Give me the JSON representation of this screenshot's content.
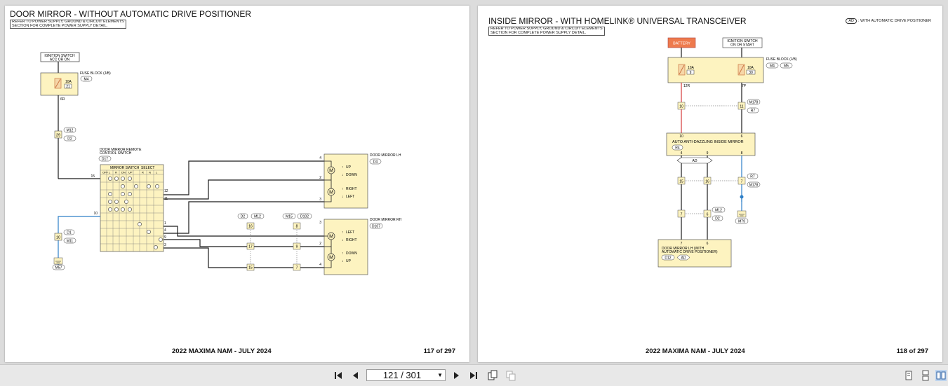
{
  "left_page": {
    "title": "DOOR MIRROR - WITHOUT AUTOMATIC DRIVE POSITIONER",
    "note": "REFER TO POWER SUPPLY, GROUND & CIRCUIT ELEMENTS\nSECTION FOR COMPLETE POWER SUPPLY DETAIL.",
    "footer_center": "2022 MAXIMA NAM - JULY 2024",
    "footer_page": "117 of 297",
    "diagram": {
      "ign_l1": "IGNITION SWITCH",
      "ign_l2": "ACC OR ON",
      "fuse_block": "FUSE BLOCK (J/B)",
      "fuse_conn": "M4",
      "fuse_amp": "10A",
      "fuse_num": "21",
      "wire_6r": "6R",
      "pin_29": "29",
      "conn_m12": "M12",
      "conn_d2": "D2",
      "switch_l1": "DOOR MIRROR REMOTE",
      "switch_l2": "CONTROL SWITCH",
      "switch_conn": "D17",
      "mirror_switch": "MIRROR SWITCH",
      "select": "SELECT",
      "col_off": "OFF",
      "col_l": "L",
      "col_r": "R",
      "col_dn": "DN",
      "col_up": "UP",
      "col_sr": "R",
      "col_sn": "N",
      "col_sl": "L",
      "pin_15": "15",
      "pin_12": "12",
      "pin_11": "11",
      "pin_10": "10",
      "pin_1": "1",
      "pin_4": "4",
      "pin_9": "9",
      "pin_3": "3",
      "gnd_pin": "10",
      "gnd_conn_d1": "D1",
      "gnd_conn_m11": "M11",
      "gnd_m57": "M57",
      "mirror_lh": "DOOR MIRROR LH",
      "mirror_lh_conn": "D4",
      "lh_pin_top": "4",
      "lh_pin_mid": "2",
      "lh_pin_bot": "3",
      "lh_up": "UP",
      "lh_down": "DOWN",
      "lh_right": "RIGHT",
      "lh_left": "LEFT",
      "mirror_rh": "DOOR MIRROR RH",
      "mirror_rh_conn": "D107",
      "rh_pin_top": "3",
      "rh_pin_mid": "2",
      "rh_pin_bot": "4",
      "rh_left": "LEFT",
      "rh_right": "RIGHT",
      "rh_down": "DOWN",
      "rh_up": "UP",
      "jc_d2": "D2",
      "jc_m12": "M12",
      "jc_m15": "M15",
      "jc_d102": "D102",
      "jc_16": "16",
      "jc_17": "17",
      "jc_15": "15",
      "jc_8": "8",
      "jc_9": "9",
      "jc_7": "7",
      "motor": "M"
    }
  },
  "right_page": {
    "title": "INSIDE MIRROR - WITH HOMELINK® UNIVERSAL TRANSCEIVER",
    "note": "REFER TO POWER SUPPLY, GROUND & CIRCUIT ELEMENTS\nSECTION FOR COMPLETE POWER SUPPLY DETAIL.",
    "legend_code": "AD",
    "legend_text": ": WITH AUTOMATIC DRIVE POSITIONER",
    "footer_center": "2022 MAXIMA NAM - JULY 2024",
    "footer_page": "118 of 297",
    "diagram": {
      "battery": "BATTERY",
      "ign_l1": "IGNITION SWITCH",
      "ign_l2": "ON OR START",
      "fuse_block": "FUSE BLOCK (J/B)",
      "fuse_conn1": "M4",
      "fuse_conn2": "M5",
      "fuse1_amp": "10A",
      "fuse1_num": "9",
      "fuse2_amp": "10A",
      "fuse2_num": "30",
      "wire_12r": "12R",
      "wire_7p": "7P",
      "pin_10": "10",
      "pin_11": "11",
      "conn_m178": "M178",
      "conn_r7": "R7",
      "amir_pin10": "10",
      "amir_pin6": "6",
      "amir_name": "AUTO ANTI-DAZZLING INSIDE MIRROR",
      "amir_conn": "R4",
      "amir_pin4": "4",
      "amir_pin9": "9",
      "amir_pin8": "8",
      "ad_tag": "AD",
      "pin_15": "15",
      "pin_16": "16",
      "pin_7a": "7",
      "conn_r7b": "R7",
      "conn_m178b": "M178",
      "gnd_m79": "M79",
      "pin_7b": "7",
      "pin_6": "6",
      "conn_m12": "M12",
      "conn_d2": "D2",
      "dm_pin7": "7",
      "dm_pin6": "6",
      "dm_l1": "DOOR MIRROR LH (WITH",
      "dm_l2": "AUTOMATIC DRIVE POSITIONER)",
      "dm_conn": "D12",
      "dm_ad": "AD"
    }
  },
  "toolbar": {
    "page_value": "121 / 301"
  },
  "colors": {
    "wire_black": "#1a1a1a",
    "wire_red": "#d63a3a",
    "wire_blue": "#2d7fc7",
    "component_fill": "#fdf3c0",
    "battery_fill": "#ee7a4d"
  }
}
